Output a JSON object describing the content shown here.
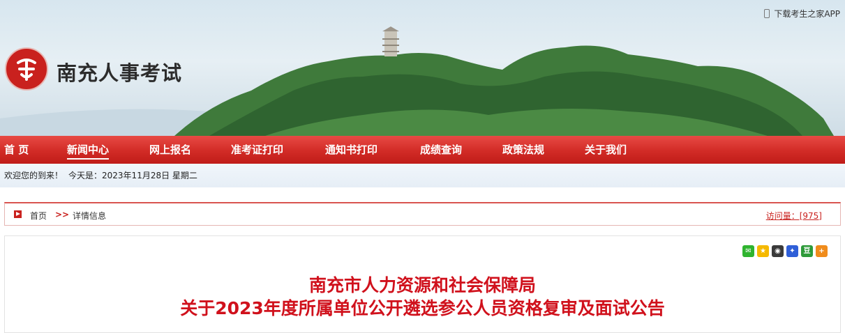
{
  "header": {
    "site_title": "南充人事考试",
    "app_link": "下载考生之家APP",
    "logo_glyph": "人"
  },
  "nav": {
    "items": [
      {
        "label": "首 页"
      },
      {
        "label": "新闻中心",
        "active": true
      },
      {
        "label": "网上报名"
      },
      {
        "label": "准考证打印"
      },
      {
        "label": "通知书打印"
      },
      {
        "label": "成绩查询"
      },
      {
        "label": "政策法规"
      },
      {
        "label": "关于我们"
      }
    ]
  },
  "welcome": {
    "greeting": "欢迎您的到来！",
    "today": "今天是：2023年11月28日 星期二"
  },
  "breadcrumb": {
    "home": "首页",
    "separator": ">>",
    "current": "详情信息",
    "visits": "访问量：[975]"
  },
  "share": {
    "icons": [
      {
        "name": "wechat-icon",
        "color": "#2fb42f",
        "glyph": "✉"
      },
      {
        "name": "qzone-icon",
        "color": "#f5b900",
        "glyph": "★"
      },
      {
        "name": "qq-icon",
        "color": "#3a3a3a",
        "glyph": "◉"
      },
      {
        "name": "baidu-icon",
        "color": "#2f5fd8",
        "glyph": "✦"
      },
      {
        "name": "douban-icon",
        "color": "#2e9b3a",
        "glyph": "豆"
      },
      {
        "name": "more-share-icon",
        "color": "#f08c1c",
        "glyph": "+"
      }
    ]
  },
  "article": {
    "title_line1": "南充市人力资源和社会保障局",
    "title_line2": "关于2023年度所属单位公开遴选参公人员资格复审及面试公告"
  },
  "colors": {
    "accent_red": "#d0111c",
    "nav_red": "#d22b26"
  }
}
